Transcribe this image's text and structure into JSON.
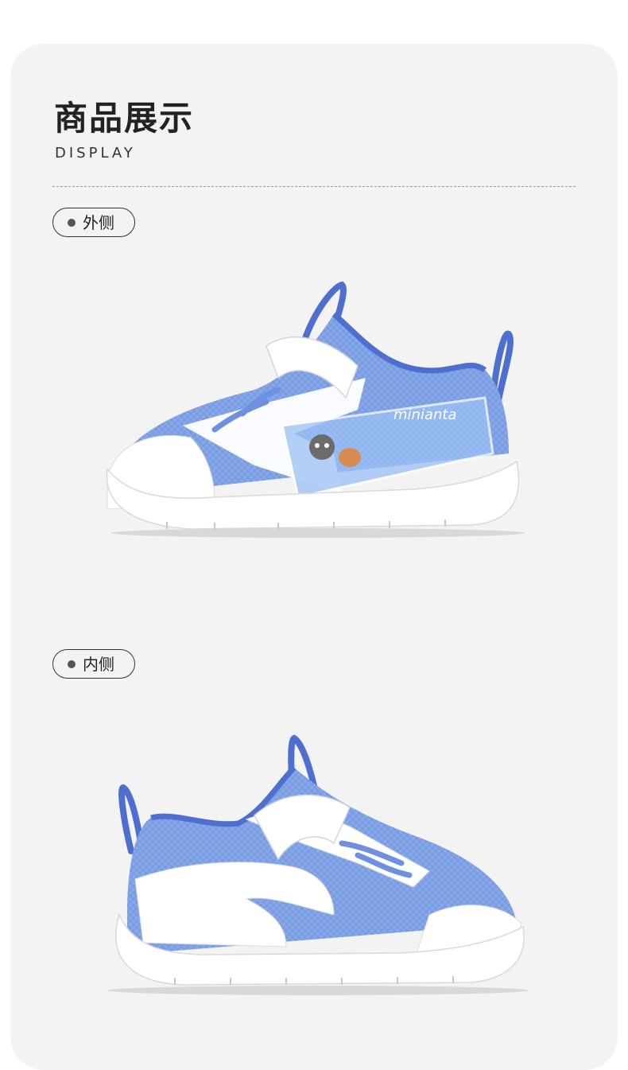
{
  "header": {
    "title": "商品展示",
    "subtitle": "DISPLAY"
  },
  "views": [
    {
      "label": "外侧",
      "image": "shoe-outer-side"
    },
    {
      "label": "内侧",
      "image": "shoe-inner-side"
    }
  ],
  "shoe": {
    "brand_mark": "minianta",
    "colors": {
      "mesh": "#7fa4e6",
      "accent": "#4f6fd0",
      "upper": "#ffffff",
      "sole": "#ffffff"
    }
  }
}
